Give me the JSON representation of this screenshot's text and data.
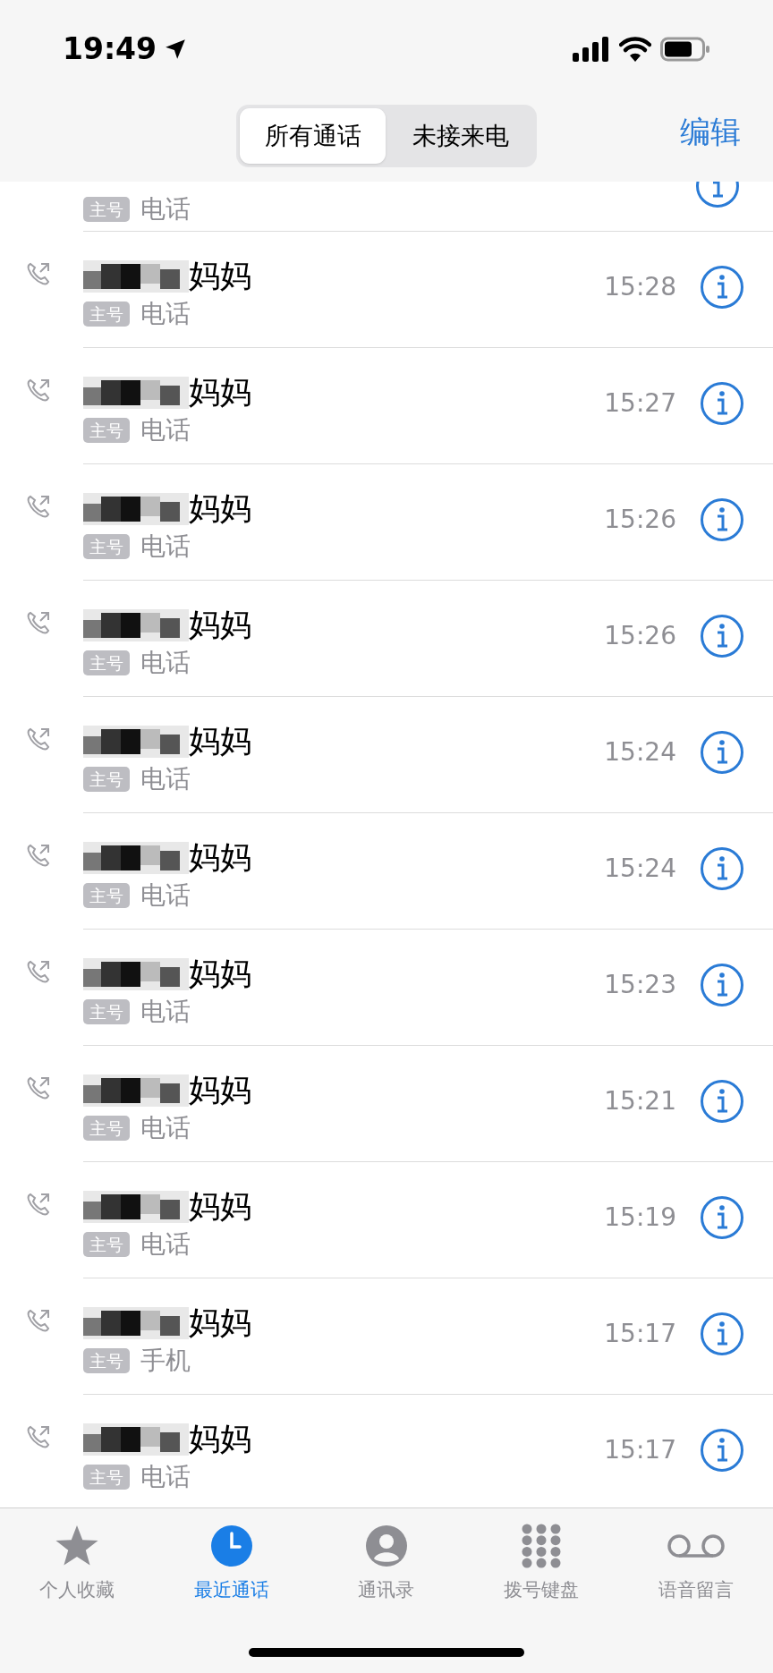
{
  "status_bar": {
    "time": "19:49"
  },
  "segments": [
    {
      "label": "所有通话",
      "selected": true
    },
    {
      "label": "未接来电",
      "selected": false
    }
  ],
  "edit_button": "编辑",
  "calls": [
    {
      "kind": "partial",
      "badge": "主号",
      "type": "电话"
    },
    {
      "kind": "full",
      "name": "妈妈",
      "badge": "主号",
      "type": "电话",
      "time": "15:28"
    },
    {
      "kind": "full",
      "name": "妈妈",
      "badge": "主号",
      "type": "电话",
      "time": "15:27"
    },
    {
      "kind": "full",
      "name": "妈妈",
      "badge": "主号",
      "type": "电话",
      "time": "15:26"
    },
    {
      "kind": "full",
      "name": "妈妈",
      "badge": "主号",
      "type": "电话",
      "time": "15:26"
    },
    {
      "kind": "full",
      "name": "妈妈",
      "badge": "主号",
      "type": "电话",
      "time": "15:24"
    },
    {
      "kind": "full",
      "name": "妈妈",
      "badge": "主号",
      "type": "电话",
      "time": "15:24"
    },
    {
      "kind": "full",
      "name": "妈妈",
      "badge": "主号",
      "type": "电话",
      "time": "15:23"
    },
    {
      "kind": "full",
      "name": "妈妈",
      "badge": "主号",
      "type": "电话",
      "time": "15:21"
    },
    {
      "kind": "full",
      "name": "妈妈",
      "badge": "主号",
      "type": "电话",
      "time": "15:19"
    },
    {
      "kind": "full",
      "name": "妈妈",
      "badge": "主号",
      "type": "手机",
      "time": "15:17"
    },
    {
      "kind": "full",
      "name": "妈妈",
      "badge": "主号",
      "type": "电话",
      "time": "15:17"
    }
  ],
  "tabs": [
    {
      "kind": "favorites",
      "label": "个人收藏",
      "selected": false
    },
    {
      "kind": "recents",
      "label": "最近通话",
      "selected": true
    },
    {
      "kind": "contacts",
      "label": "通讯录",
      "selected": false
    },
    {
      "kind": "keypad",
      "label": "拨号键盘",
      "selected": false
    },
    {
      "kind": "voicemail",
      "label": "语音留言",
      "selected": false
    }
  ]
}
